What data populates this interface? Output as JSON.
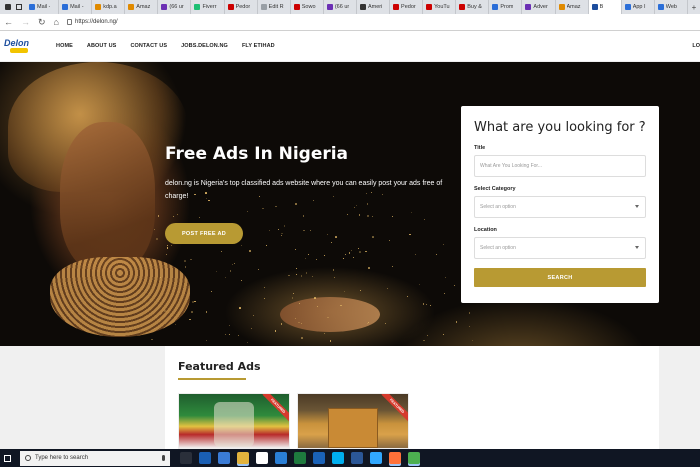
{
  "browser": {
    "tabs": [
      {
        "label": "Mail -",
        "color": "#2b6ed8"
      },
      {
        "label": "Mail -",
        "color": "#2b6ed8"
      },
      {
        "label": "kdp.a",
        "color": "#e08a00"
      },
      {
        "label": "Amaz",
        "color": "#e08a00"
      },
      {
        "label": "(66 ur",
        "color": "#6b2fb4"
      },
      {
        "label": "Fiverr",
        "color": "#1dbf73"
      },
      {
        "label": "Pedor",
        "color": "#cc0000"
      },
      {
        "label": "Edit R",
        "color": "#9aa0a6"
      },
      {
        "label": "Sowo",
        "color": "#cc0000"
      },
      {
        "label": "(66 ur",
        "color": "#6b2fb4"
      },
      {
        "label": "Ameri",
        "color": "#333333"
      },
      {
        "label": "Pedor",
        "color": "#cc0000"
      },
      {
        "label": "YouTu",
        "color": "#cc0000"
      },
      {
        "label": "Buy &",
        "color": "#cc0000"
      },
      {
        "label": "Prom",
        "color": "#2b6ed8"
      },
      {
        "label": "Adver",
        "color": "#6b2fb4"
      },
      {
        "label": "Amaz",
        "color": "#e08a00"
      },
      {
        "label": "B",
        "color": "#1d4e9e",
        "active": true
      },
      {
        "label": "App I",
        "color": "#2b6ed8"
      },
      {
        "label": "Web",
        "color": "#2b6ed8"
      }
    ],
    "new_tab": "+",
    "url": "https://delon.ng/"
  },
  "site": {
    "logo_text": "Delon",
    "nav": [
      "HOME",
      "ABOUT US",
      "CONTACT US",
      "JOBS.DELON.NG",
      "FLY ETIHAD"
    ],
    "login_label": "LO"
  },
  "hero": {
    "title": "Free Ads In Nigeria",
    "description": "delon.ng is Nigeria's top classified ads website where you can easily post your ads free of charge!",
    "post_button": "POST FREE AD"
  },
  "search": {
    "heading": "What are you looking for ?",
    "title_label": "Title",
    "title_placeholder": "What Are You Looking For...",
    "category_label": "Select Category",
    "category_value": "Select an option",
    "location_label": "Location",
    "location_value": "Select an option",
    "button": "SEARCH"
  },
  "featured": {
    "title": "Featured Ads",
    "ribbon": "FEATURED"
  },
  "taskbar": {
    "search_placeholder": "Type here to search",
    "icons": [
      "task-view-icon",
      "cortana-icon",
      "mail-icon",
      "file-explorer-icon",
      "amazon-icon",
      "vs-code-icon",
      "excel-icon",
      "outlook-icon",
      "skype-icon",
      "word-icon",
      "photoshop-icon",
      "firefox-icon",
      "chrome-icon"
    ]
  },
  "colors": {
    "accent_gold": "#b89a33",
    "ribbon_red": "#d63a2c",
    "brand_blue": "#1d4e9e"
  }
}
